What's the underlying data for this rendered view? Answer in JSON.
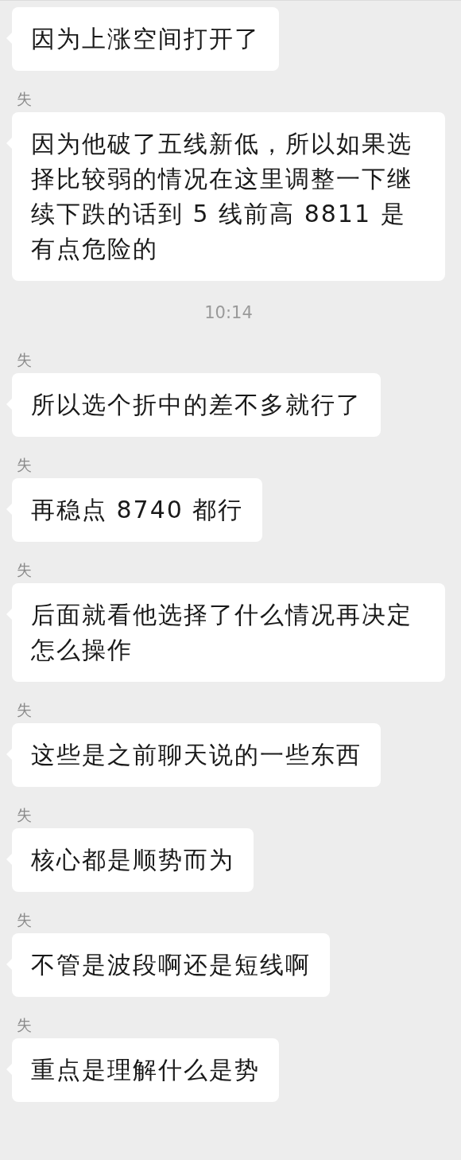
{
  "messages": [
    {
      "kind": "message",
      "text": "因为上涨空间打开了"
    },
    {
      "kind": "message",
      "sender": "失",
      "text": "因为他破了五线新低，所以如果选择比较弱的情况在这里调整一下继续下跌的话到 5 线前高 8811 是有点危险的"
    },
    {
      "kind": "time",
      "text": "10:14"
    },
    {
      "kind": "message",
      "sender": "失",
      "text": "所以选个折中的差不多就行了"
    },
    {
      "kind": "message",
      "sender": "失",
      "text": "再稳点 8740 都行"
    },
    {
      "kind": "message",
      "sender": "失",
      "text": "后面就看他选择了什么情况再决定怎么操作"
    },
    {
      "kind": "message",
      "sender": "失",
      "text": "这些是之前聊天说的一些东西"
    },
    {
      "kind": "message",
      "sender": "失",
      "text": "核心都是顺势而为"
    },
    {
      "kind": "message",
      "sender": "失",
      "text": "不管是波段啊还是短线啊"
    },
    {
      "kind": "message",
      "sender": "失",
      "text": "重点是理解什么是势"
    }
  ]
}
